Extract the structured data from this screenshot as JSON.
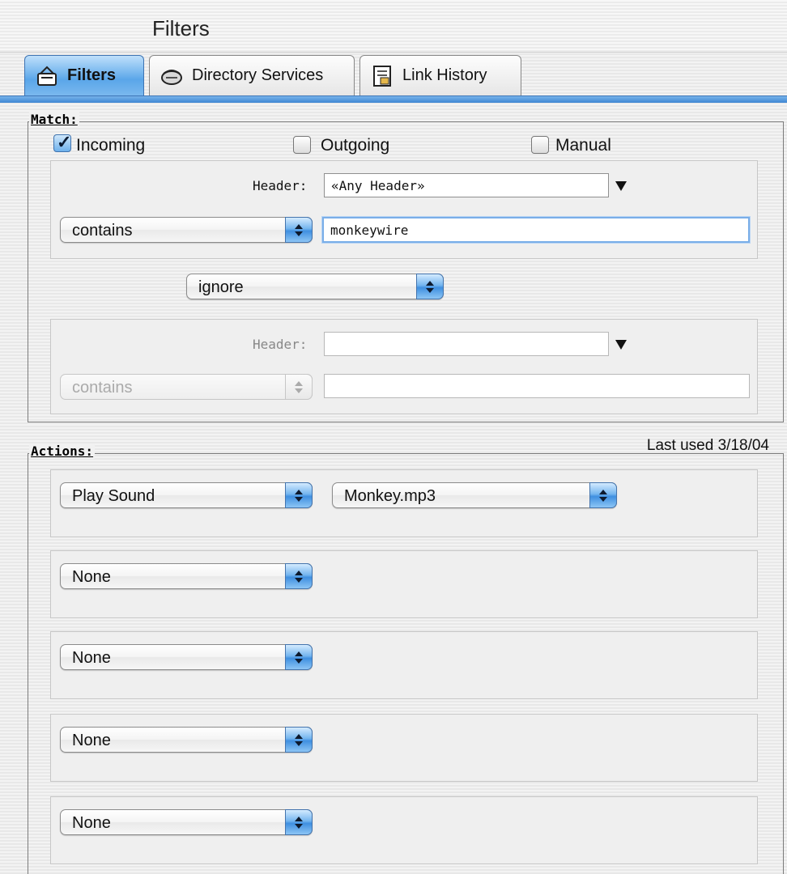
{
  "window": {
    "title": "Filters"
  },
  "tabs": [
    {
      "label": "Filters",
      "icon": "filters-tab-icon",
      "active": true
    },
    {
      "label": "Directory Services",
      "icon": "directory-services-icon",
      "active": false
    },
    {
      "label": "Link History",
      "icon": "link-history-icon",
      "active": false
    }
  ],
  "match": {
    "title": "Match:",
    "checkboxes": [
      {
        "label": "Incoming",
        "checked": true
      },
      {
        "label": "Outgoing",
        "checked": false
      },
      {
        "label": "Manual",
        "checked": false
      }
    ],
    "criteria1": {
      "header_label": "Header:",
      "header_value": "«Any Header»",
      "operator": "contains",
      "value": "monkeywire"
    },
    "conjunction": "ignore",
    "criteria2": {
      "header_label": "Header:",
      "header_value": "",
      "operator": "contains",
      "value": ""
    }
  },
  "actions": {
    "title": "Actions:",
    "last_used": "Last used 3/18/04",
    "rows": [
      {
        "action": "Play Sound",
        "parameter": "Monkey.mp3"
      },
      {
        "action": "None"
      },
      {
        "action": "None"
      },
      {
        "action": "None"
      },
      {
        "action": "None"
      }
    ]
  },
  "colors": {
    "accent": "#5aa6e9",
    "checkbox": "#6eb1ec"
  }
}
